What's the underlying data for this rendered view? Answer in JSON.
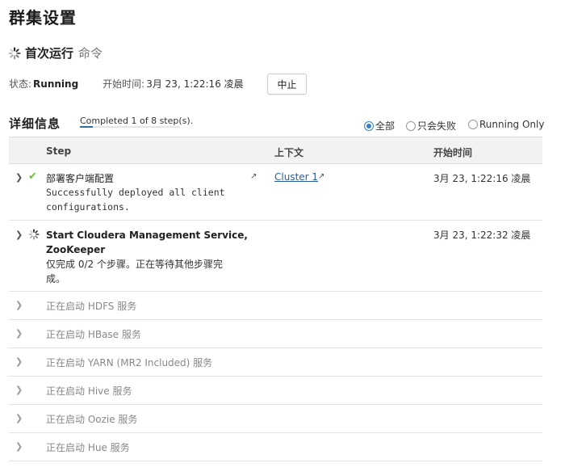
{
  "page": {
    "title": "群集设置"
  },
  "command": {
    "title": "首次运行",
    "subtitle": "命令"
  },
  "status": {
    "label": "状态:",
    "value": "Running",
    "start_label": "开始时间:",
    "start_value": "3月 23, 1:22:16 凌晨",
    "stop_button": "中止"
  },
  "details": {
    "title": "详细信息",
    "progress_text": "Completed 1 of 8 step(s).",
    "progress_fraction": 0.125
  },
  "filters": [
    {
      "label": "全部",
      "checked": true
    },
    {
      "label": "只会失败",
      "checked": false
    },
    {
      "label": "Running Only",
      "checked": false
    }
  ],
  "table": {
    "columns": [
      "Step",
      "上下文",
      "开始时间"
    ],
    "rows": [
      {
        "title": "部署客户端配置",
        "desc_line1": "Successfully deployed all client",
        "desc_line2": "configurations.",
        "context": "Cluster 1",
        "time": "3月 23, 1:22:16 凌晨",
        "status": "success"
      },
      {
        "title_line1": "Start Cloudera Management Service,",
        "title_line2": "ZooKeeper",
        "desc_line1": "仅完成 0/2 个步骤。正在等待其他步骤完",
        "desc_line2": "成。",
        "time": "3月 23, 1:22:32 凌晨",
        "status": "running"
      },
      {
        "title": "正在启动 HDFS 服务"
      },
      {
        "title": "正在启动 HBase 服务"
      },
      {
        "title": "正在启动 YARN (MR2 Included) 服务"
      },
      {
        "title": "正在启动 Hive 服务"
      },
      {
        "title": "正在启动 Oozie 服务"
      },
      {
        "title": "正在启动 Hue 服务"
      }
    ]
  },
  "colors": {
    "accent": "#3a7fc4",
    "success": "#6abf3a",
    "link": "#2a5d9c"
  },
  "icons": [
    "spinner-icon",
    "check-icon",
    "chevron-right-icon",
    "external-link-icon"
  ]
}
